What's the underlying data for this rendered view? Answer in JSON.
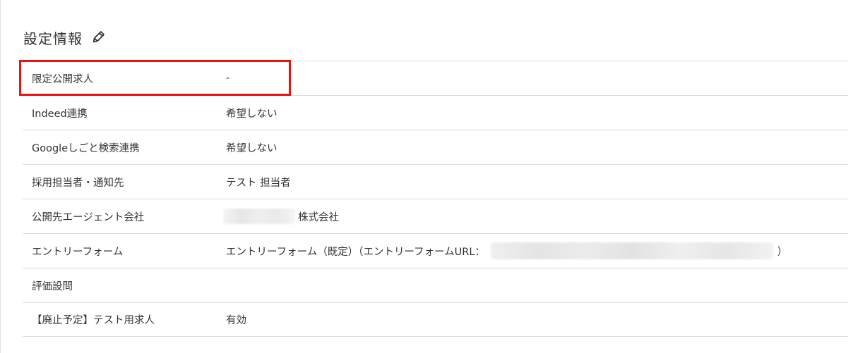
{
  "section": {
    "title": "設定情報",
    "edit_icon": "pencil-icon"
  },
  "rows": [
    {
      "label": "限定公開求人",
      "value": "-"
    },
    {
      "label": "Indeed連携",
      "value": "希望しない"
    },
    {
      "label": "Googleしごと検索連携",
      "value": "希望しない"
    },
    {
      "label": "採用担当者・通知先",
      "value": "テスト 担当者"
    },
    {
      "label": "公開先エージェント会社",
      "value_suffix": "株式会社"
    },
    {
      "label": "エントリーフォーム",
      "value_prefix": "エントリーフォーム（既定）（エントリーフォームURL：",
      "value_suffix": "）"
    },
    {
      "label": "評価設問",
      "value": ""
    },
    {
      "label": "【廃止予定】テスト用求人",
      "value": "有効"
    }
  ],
  "colors": {
    "highlight": "#ee1111",
    "divider": "#dddddd",
    "text": "#333333"
  }
}
